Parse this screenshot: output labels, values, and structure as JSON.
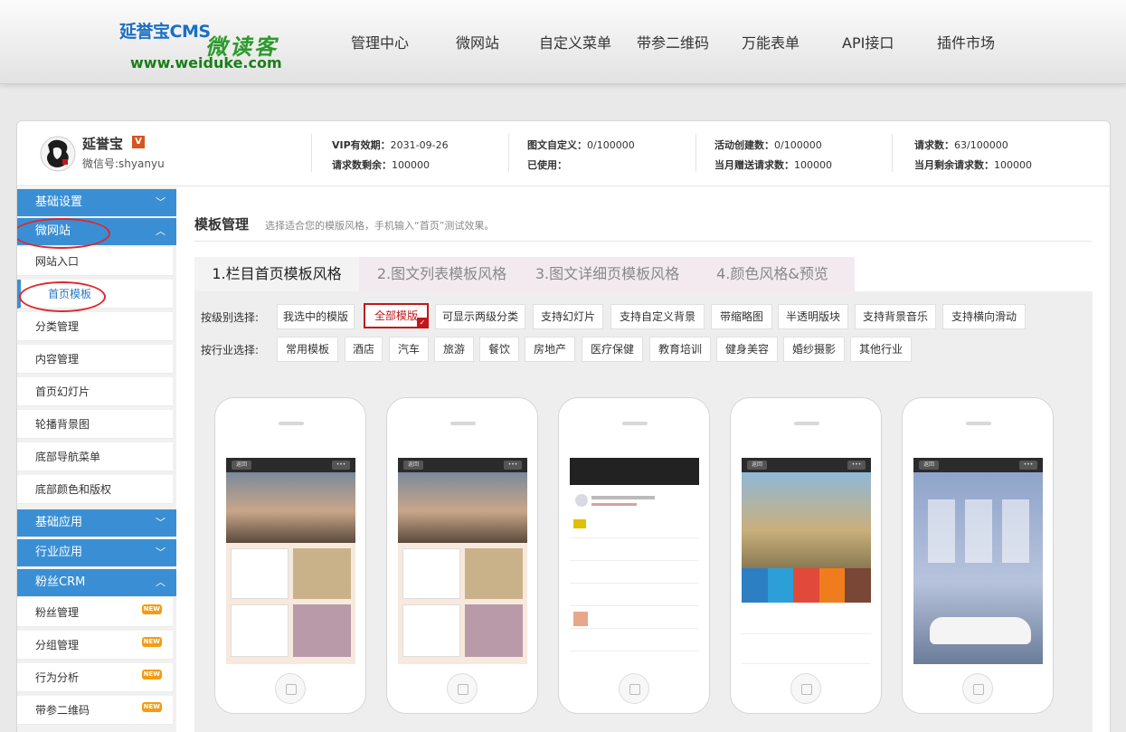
{
  "header": {
    "logo_line1": "延誉宝CMS",
    "logo_line2": "微读客",
    "logo_line3": "www.weiduke.com",
    "nav": [
      "管理中心",
      "微网站",
      "自定义菜单",
      "带参二维码",
      "万能表单",
      "API接口",
      "插件市场"
    ]
  },
  "user": {
    "name": "延誉宝",
    "vip_mark": "V",
    "wechat": "微信号:shyanyu"
  },
  "stats": {
    "vip_label": "VIP有效期：",
    "vip_value": "2031-09-26",
    "req_left_label": "请求数剩余：",
    "req_left_value": "100000",
    "pic_label": "图文自定义：",
    "pic_value": "0/100000",
    "used_label": "已使用：",
    "used_value": "",
    "act_label": "活动创建数：",
    "act_value": "0/100000",
    "gift_label": "当月赠送请求数：",
    "gift_value": "100000",
    "req_label": "请求数：",
    "req_value": "63/100000",
    "month_left_label": "当月剩余请求数：",
    "month_left_value": "100000"
  },
  "sidebar": {
    "sections": [
      {
        "label": "基础设置",
        "chev": "﹀"
      },
      {
        "label": "微网站",
        "chev": "︿"
      },
      {
        "label": "基础应用",
        "chev": "﹀"
      },
      {
        "label": "行业应用",
        "chev": "﹀"
      },
      {
        "label": "粉丝CRM",
        "chev": "︿"
      }
    ],
    "weisite_items": [
      "网站入口",
      "首页模板",
      "分类管理",
      "内容管理",
      "首页幻灯片",
      "轮播背景图",
      "底部导航菜单",
      "底部颜色和版权"
    ],
    "crm_items": [
      "粉丝管理",
      "分组管理",
      "行为分析",
      "带参二维码"
    ],
    "new_badge": "NEW"
  },
  "content": {
    "title": "模板管理",
    "subtitle": "选择适合您的模版风格，手机输入“首页”测试效果。",
    "tabs": [
      "1.栏目首页模板风格",
      "2.图文列表模板风格",
      "3.图文详细页模板风格",
      "4.颜色风格&预览"
    ],
    "level_label": "按级别选择:",
    "level_filters": [
      "我选中的模版",
      "全部模版",
      "可显示两级分类",
      "支持幻灯片",
      "支持自定义背景",
      "带缩略图",
      "半透明版块",
      "支持背景音乐",
      "支持横向滑动"
    ],
    "industry_label": "按行业选择:",
    "industry_filters": [
      "常用模板",
      "酒店",
      "汽车",
      "旅游",
      "餐饮",
      "房地产",
      "医疗保健",
      "教育培训",
      "健身美容",
      "婚纱摄影",
      "其他行业"
    ],
    "phone_back": "返回",
    "phone_more": "•••"
  },
  "colors": {
    "accent": "#3a8fd4",
    "selected": "#c0171c",
    "highlight": "#e0272c"
  }
}
